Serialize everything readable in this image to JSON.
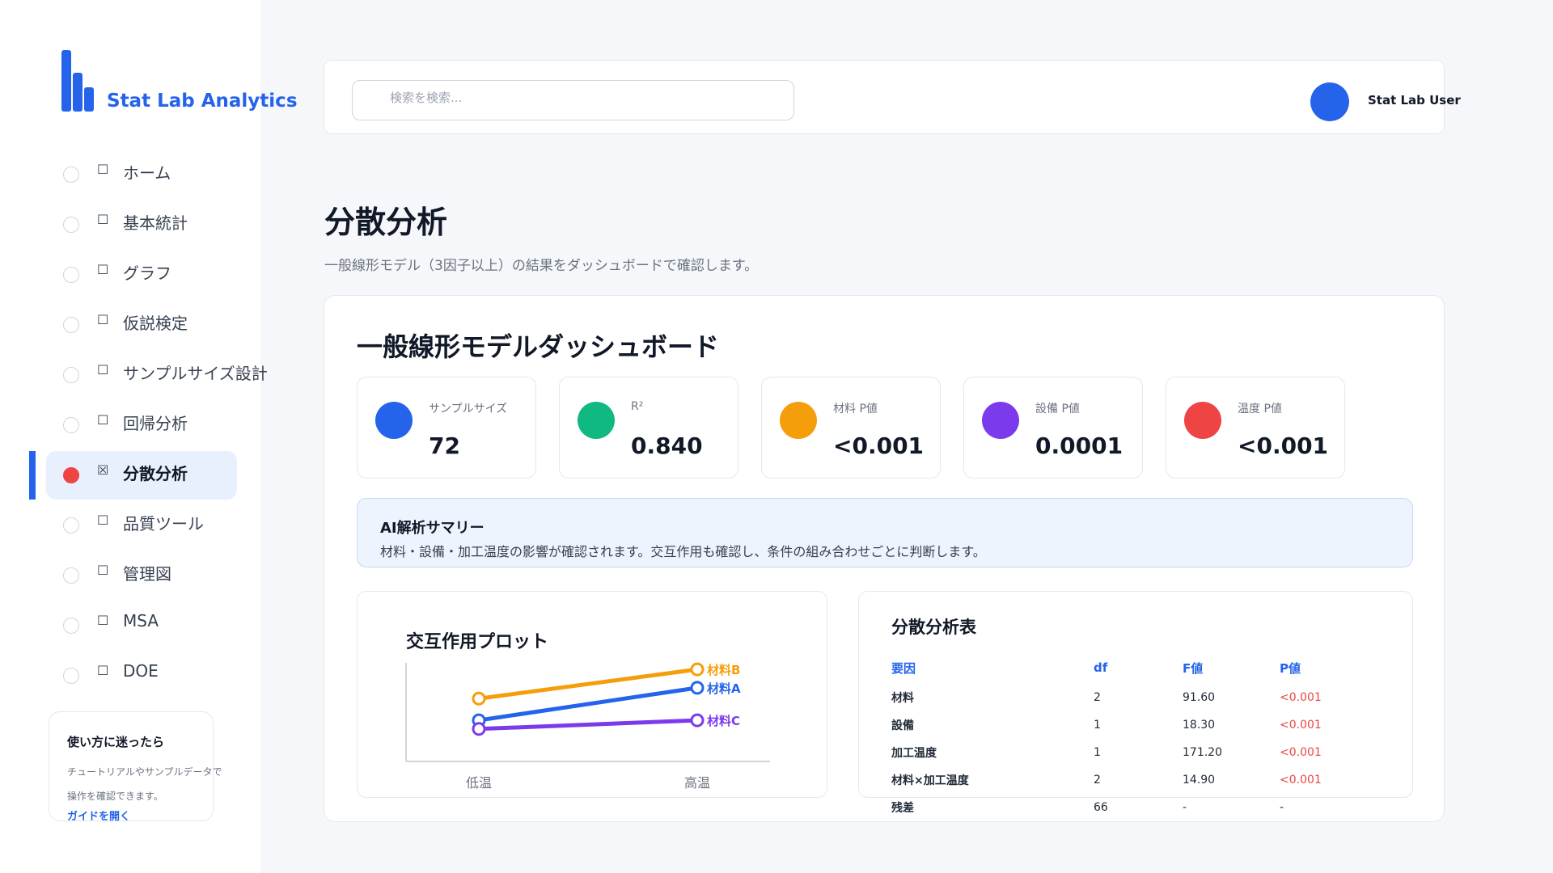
{
  "app": {
    "name": "Stat Lab Analytics"
  },
  "sidebar": {
    "items": [
      {
        "label": "ホーム",
        "active": false
      },
      {
        "label": "基本統計",
        "active": false
      },
      {
        "label": "グラフ",
        "active": false
      },
      {
        "label": "仮説検定",
        "active": false
      },
      {
        "label": "サンプルサイズ設計",
        "active": false
      },
      {
        "label": "回帰分析",
        "active": false
      },
      {
        "label": "分散分析",
        "active": true
      },
      {
        "label": "品質ツール",
        "active": false
      },
      {
        "label": "管理図",
        "active": false
      },
      {
        "label": "MSA",
        "active": false
      },
      {
        "label": "DOE",
        "active": false
      }
    ],
    "box_glyph": "☐",
    "box_glyph_active": "☒",
    "help": {
      "title": "使い方に迷ったら",
      "text": "チュートリアルやサンプルデータで操作を確認できます。",
      "link": "ガイドを開く"
    }
  },
  "header": {
    "search_placeholder": "検索を検索...",
    "user_name": "Stat Lab User"
  },
  "page": {
    "title": "分散分析",
    "subtitle": "一般線形モデル（3因子以上）の結果をダッシュボードで確認します。"
  },
  "dashboard": {
    "title": "一般線形モデルダッシュボード",
    "kpis": [
      {
        "label": "サンプルサイズ",
        "value": "72",
        "color": "#2563eb"
      },
      {
        "label": "R²",
        "value": "0.840",
        "color": "#10b981"
      },
      {
        "label": "材料 P値",
        "value": "<0.001",
        "color": "#f59e0b"
      },
      {
        "label": "設備 P値",
        "value": "0.0001",
        "color": "#7c3aed"
      },
      {
        "label": "温度 P値",
        "value": "<0.001",
        "color": "#ef4444"
      }
    ],
    "ai_summary": {
      "title": "AI解析サマリー",
      "text": "材料・設備・加工温度の影響が確認されます。交互作用も確認し、条件の組み合わせごとに判断します。"
    }
  },
  "chart_data": {
    "type": "line",
    "title": "交互作用プロット",
    "categories": [
      "低温",
      "高温"
    ],
    "series": [
      {
        "name": "材料B",
        "values": [
          0.58,
          0.85
        ],
        "color": "#f59e0b"
      },
      {
        "name": "材料A",
        "values": [
          0.38,
          0.68
        ],
        "color": "#2563eb"
      },
      {
        "name": "材料C",
        "values": [
          0.3,
          0.38
        ],
        "color": "#7c3aed"
      }
    ],
    "ylim": [
      0,
      1
    ],
    "grid": false
  },
  "anova_table": {
    "title": "分散分析表",
    "columns": [
      "要因",
      "df",
      "F値",
      "P値"
    ],
    "rows": [
      [
        "材料",
        "2",
        "91.60",
        "<0.001"
      ],
      [
        "設備",
        "1",
        "18.30",
        "<0.001"
      ],
      [
        "加工温度",
        "1",
        "171.20",
        "<0.001"
      ],
      [
        "材料×加工温度",
        "2",
        "14.90",
        "<0.001"
      ],
      [
        "残差",
        "66",
        "-",
        "-"
      ]
    ]
  }
}
